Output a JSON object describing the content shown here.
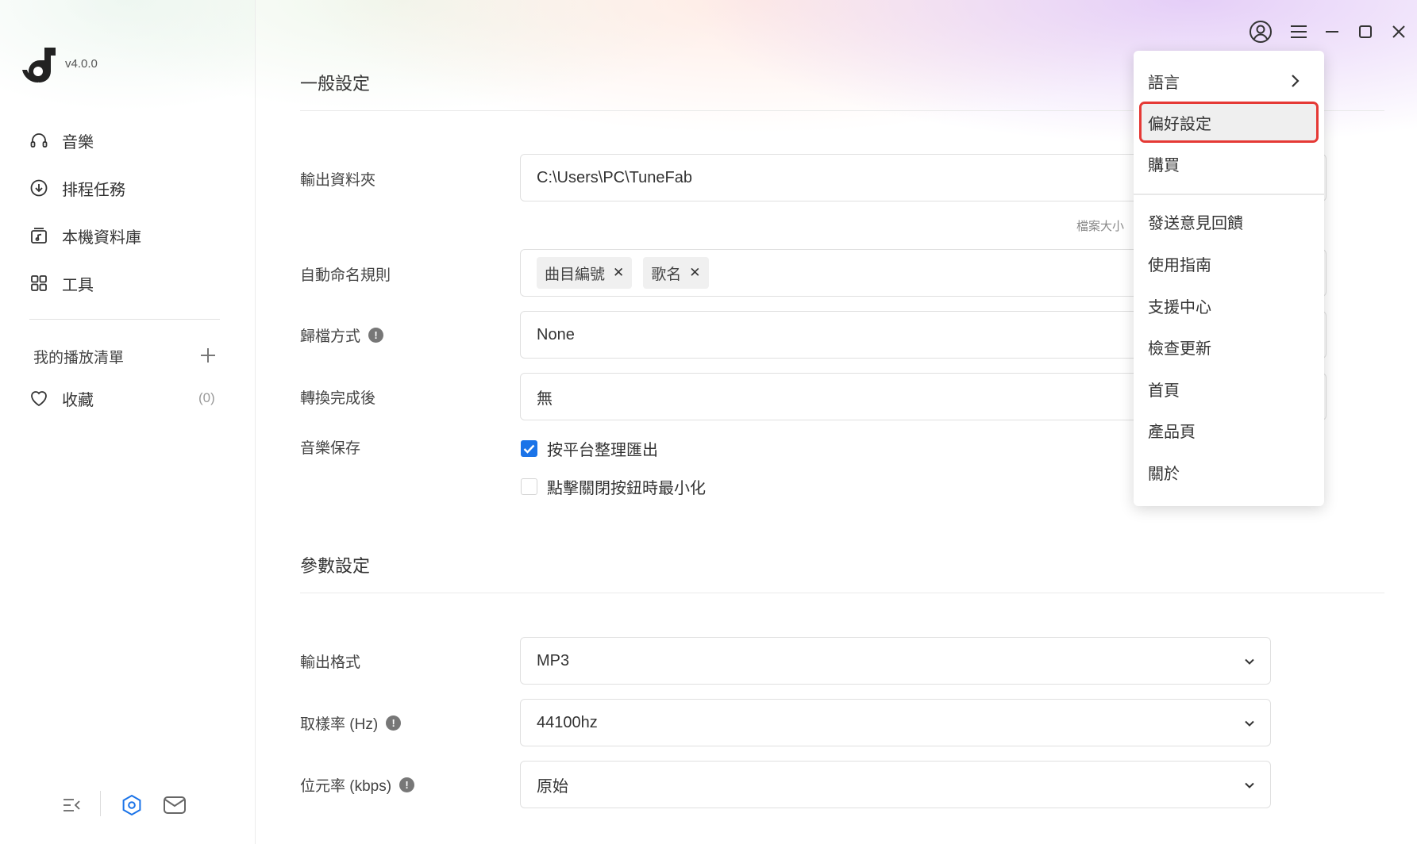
{
  "app": {
    "version": "v4.0.0"
  },
  "sidebar": {
    "items": [
      {
        "label": "音樂",
        "icon": "headphones-icon"
      },
      {
        "label": "排程任務",
        "icon": "download-icon"
      },
      {
        "label": "本機資料庫",
        "icon": "music-library-icon"
      },
      {
        "label": "工具",
        "icon": "grid-icon"
      }
    ],
    "playlist_title": "我的播放清單",
    "favorites_label": "收藏",
    "favorites_count": "(0)"
  },
  "general": {
    "title": "一般設定",
    "output_folder_label": "輸出資料夾",
    "output_folder_value": "C:\\Users\\PC\\TuneFab",
    "file_size_hint": "檔案大小",
    "naming_label": "自動命名規則",
    "naming_tags": [
      "曲目編號",
      "歌名"
    ],
    "archive_label": "歸檔方式",
    "archive_value": "None",
    "after_convert_label": "轉換完成後",
    "after_convert_value": "無",
    "music_save_label": "音樂保存",
    "checkbox_platform": {
      "label": "按平台整理匯出",
      "checked": true
    },
    "checkbox_minimize": {
      "label": "點擊關閉按鈕時最小化",
      "checked": false
    }
  },
  "params": {
    "title": "參數設定",
    "format_label": "輸出格式",
    "format_value": "MP3",
    "samplerate_label": "取樣率 (Hz)",
    "samplerate_value": "44100hz",
    "bitrate_label": "位元率 (kbps)",
    "bitrate_value": "原始"
  },
  "menu": {
    "language": "語言",
    "preferences": "偏好設定",
    "purchase": "購買",
    "feedback": "發送意見回饋",
    "guide": "使用指南",
    "support": "支援中心",
    "update": "檢查更新",
    "home": "首頁",
    "product": "產品頁",
    "about": "關於"
  },
  "colors": {
    "accent": "#1a73e8",
    "highlight_border": "#e53935"
  }
}
